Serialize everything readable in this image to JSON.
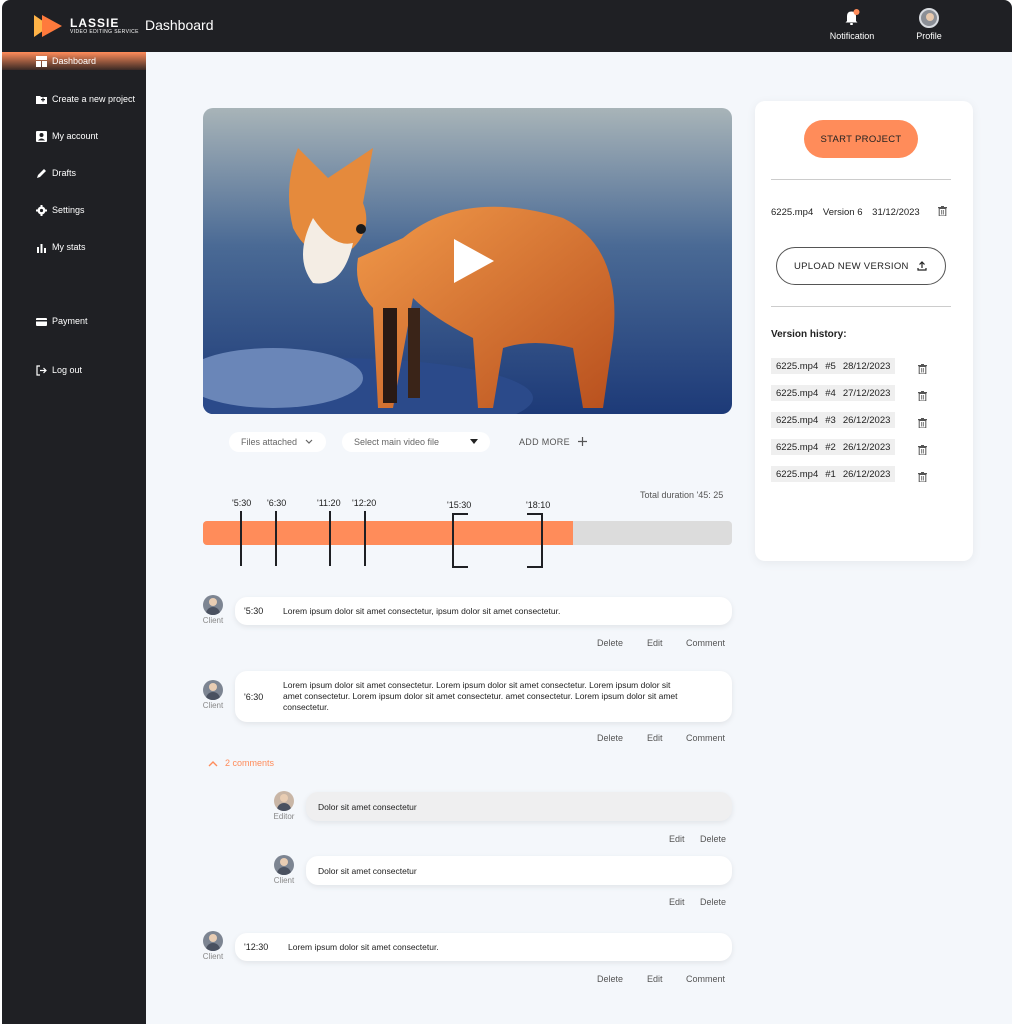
{
  "app": {
    "brand": "LASSIE",
    "brand_sub": "VIDEO EDITING SERVICE",
    "page_title": "Dashboard",
    "accent_color": "#ff8c5a",
    "dark_color": "#1f2024"
  },
  "topbar": {
    "notification_label": "Notification",
    "profile_label": "Profile"
  },
  "sidebar": {
    "items": [
      {
        "label": "Dashboard",
        "icon": "dashboard-icon",
        "active": true
      },
      {
        "label": "Create a new project",
        "icon": "folder-plus-icon"
      },
      {
        "label": "My account",
        "icon": "account-card-icon"
      },
      {
        "label": "Drafts",
        "icon": "pencil-icon"
      },
      {
        "label": "Settings",
        "icon": "gear-icon"
      },
      {
        "label": "My stats",
        "icon": "bar-chart-icon"
      },
      {
        "label": "Payment",
        "icon": "credit-card-icon"
      },
      {
        "label": "Log out",
        "icon": "logout-icon"
      }
    ]
  },
  "video": {
    "controls": {
      "files_attached": "Files attached",
      "select_placeholder": "Select main video file",
      "add_more": "ADD MORE"
    }
  },
  "timeline": {
    "total_duration": "Total duration  '45: 25",
    "progress_percent": 70,
    "markers": [
      "'5:30",
      "'6:30",
      "'11:20",
      "'12:20"
    ],
    "range": [
      "'15:30",
      "'18:10"
    ]
  },
  "comments": [
    {
      "author": "Client",
      "time": "'5:30",
      "text": "Lorem ipsum dolor sit amet consectetur, ipsum dolor sit amet consectetur.",
      "actions": [
        "Delete",
        "Edit",
        "Comment"
      ]
    },
    {
      "author": "Client",
      "time": "'6:30",
      "text_lines": [
        "Lorem ipsum dolor sit amet consectetur. Lorem ipsum dolor sit amet consectetur.  Lorem ipsum dolor sit",
        "amet consectetur. Lorem ipsum dolor sit amet  consectetur.   amet consectetur. Lorem ipsum dolor sit amet",
        "consectetur."
      ],
      "actions": [
        "Delete",
        "Edit",
        "Comment"
      ]
    },
    {
      "author": "Client",
      "time": "'12:30",
      "text": "Lorem ipsum dolor sit amet consectetur.",
      "actions": [
        "Delete",
        "Edit",
        "Comment"
      ]
    }
  ],
  "replies_toggle": "2 comments",
  "replies": [
    {
      "author": "Editor",
      "text": "Dolor sit amet consectetur",
      "actions": [
        "Edit",
        "Delete"
      ]
    },
    {
      "author": "Client",
      "text": "Dolor sit amet consectetur",
      "actions": [
        "Edit",
        "Delete"
      ]
    }
  ],
  "panel": {
    "start_label": "START PROJECT",
    "current_version": {
      "file": "6225.mp4",
      "version": "Version  6",
      "date": "31/12/2023"
    },
    "upload_label": "UPLOAD NEW VERSION",
    "history_title": "Version history:",
    "history": [
      {
        "file": "6225.mp4",
        "num": "#5",
        "date": "28/12/2023"
      },
      {
        "file": "6225.mp4",
        "num": "#4",
        "date": "27/12/2023"
      },
      {
        "file": "6225.mp4",
        "num": "#3",
        "date": "26/12/2023"
      },
      {
        "file": "6225.mp4",
        "num": "#2",
        "date": "26/12/2023"
      },
      {
        "file": "6225.mp4",
        "num": "#1",
        "date": "26/12/2023"
      }
    ]
  }
}
